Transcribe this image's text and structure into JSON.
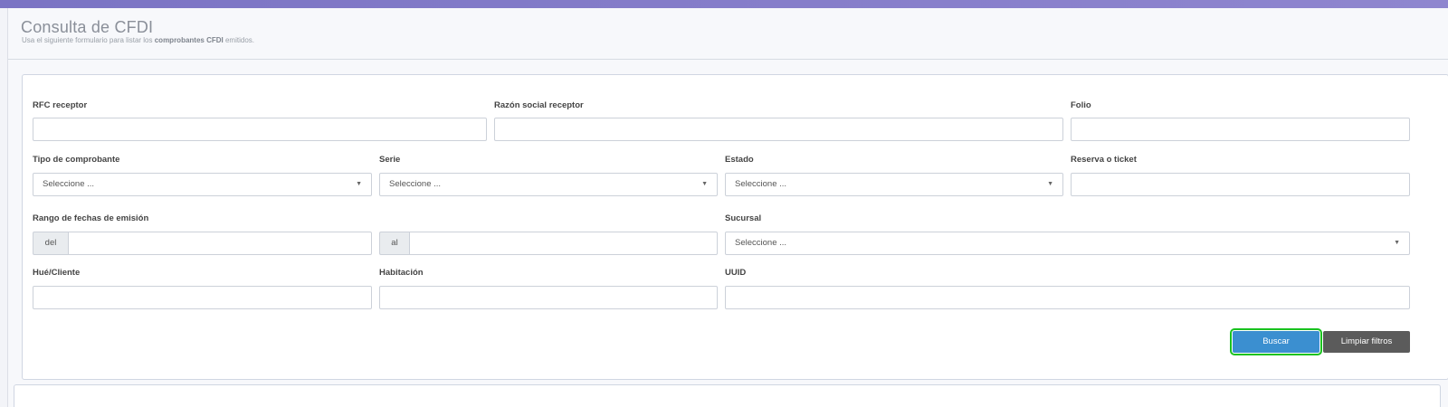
{
  "header": {
    "title": "Consulta de CFDI",
    "subtitle_prefix": "Usa el siguiente formulario para listar los ",
    "subtitle_bold": "comprobantes CFDI",
    "subtitle_suffix": " emitidos."
  },
  "form": {
    "rfc_label": "RFC receptor",
    "rfc_value": "",
    "razon_label": "Razón social receptor",
    "razon_value": "",
    "folio_label": "Folio",
    "folio_value": "",
    "tipo_label": "Tipo de comprobante",
    "tipo_selected": "Seleccione ...",
    "serie_label": "Serie",
    "serie_selected": "Seleccione ...",
    "estado_label": "Estado",
    "estado_selected": "Seleccione ...",
    "reserva_label": "Reserva o ticket",
    "reserva_value": "",
    "rango_label": "Rango de fechas de emisión",
    "del_addon": "del",
    "al_addon": "al",
    "sucursal_label": "Sucursal",
    "sucursal_selected": "Seleccione ...",
    "huesped_label": "Hué/Cliente",
    "huesped_value": "",
    "habitacion_label": "Habitación",
    "habitacion_value": "",
    "uuid_label": "UUID",
    "uuid_value": ""
  },
  "actions": {
    "search_label": "Buscar",
    "clear_label": "Limpiar filtros"
  },
  "colors": {
    "accent_bar": "#7b74c4",
    "primary_button": "#3b8fd0",
    "focus_outline": "#19c21f",
    "secondary_button": "#5b5b5b"
  },
  "icons": {
    "select_caret": "▼"
  }
}
